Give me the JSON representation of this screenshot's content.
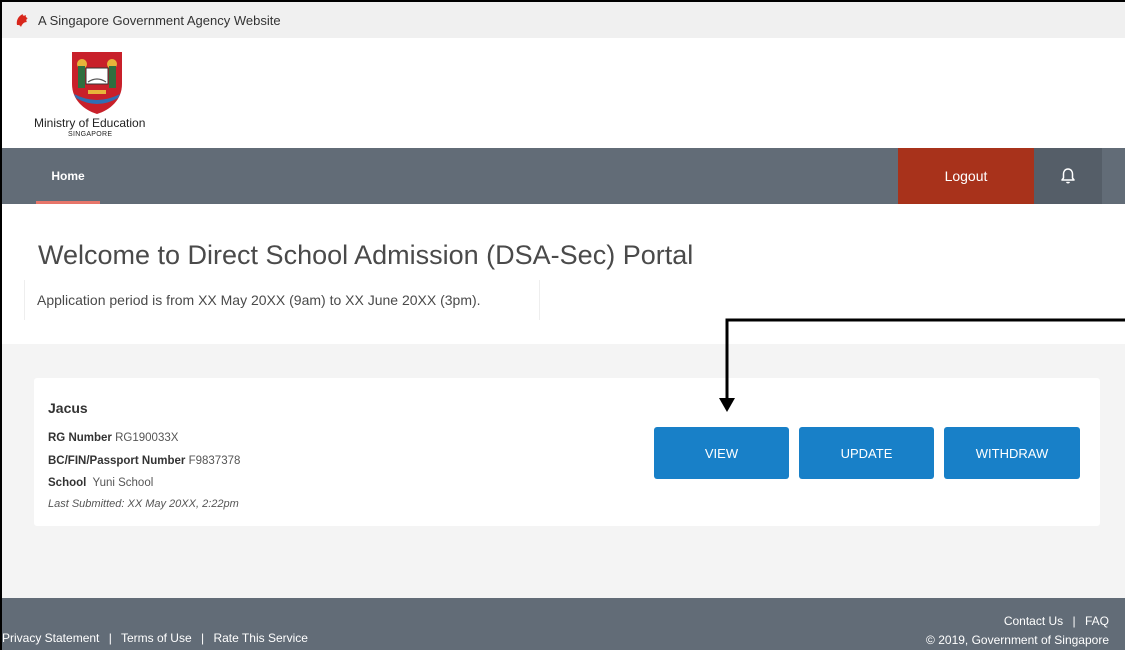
{
  "gov_banner": {
    "text": "A Singapore Government Agency Website"
  },
  "brand": {
    "name": "Ministry of Education",
    "sub": "SINGAPORE"
  },
  "nav": {
    "home": "Home",
    "logout": "Logout",
    "notifications_icon": "bell-icon"
  },
  "hero": {
    "title": "Welcome to Direct School Admission (DSA-Sec) Portal",
    "subtitle": "Application period is from XX May 20XX (9am) to XX June 20XX (3pm)."
  },
  "application": {
    "name": "Jacus",
    "rg_label": "RG Number",
    "rg_value": "RG190033X",
    "id_label": "BC/FIN/Passport Number",
    "id_value": "F9837378",
    "school_label": "School",
    "school_value": "Yuni School",
    "last_submitted": "Last Submitted: XX May 20XX, 2:22pm",
    "buttons": {
      "view": "VIEW",
      "update": "UPDATE",
      "withdraw": "WITHDRAW"
    }
  },
  "footer": {
    "links": [
      "Privacy Statement",
      "Terms of Use",
      "Rate This Service"
    ],
    "right_links": [
      "Contact Us",
      "FAQ"
    ],
    "copyright": "© 2019, Government of Singapore",
    "separator": "|"
  },
  "colors": {
    "nav": "#626c77",
    "logout": "#a8321b",
    "button": "#1880c8",
    "home_underline": "#e8766a"
  }
}
